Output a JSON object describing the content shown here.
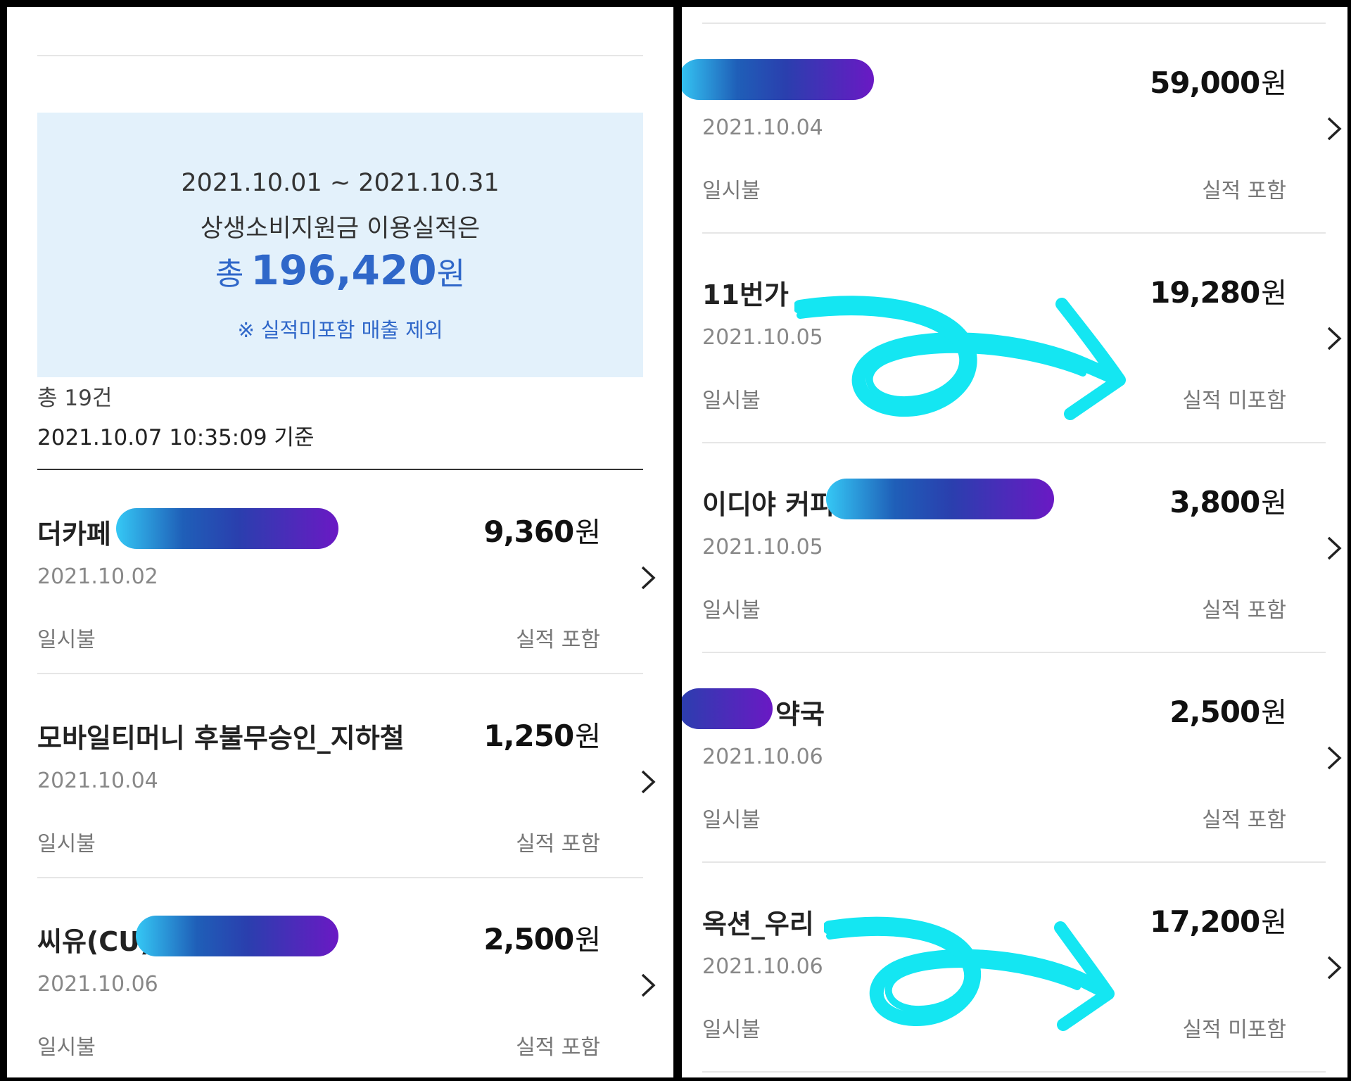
{
  "summary": {
    "date_range": "2021.10.01 ~ 2021.10.31",
    "label": "상생소비지원금 이용실적은",
    "total_prefix": "총",
    "total_amount": "196,420",
    "total_currency": "원",
    "note": "※ 실적미포함 매출 제외"
  },
  "list_info": {
    "count": "총 19건",
    "as_of": "2021.10.07 10:35:09 기준"
  },
  "left_transactions": [
    {
      "merchant": "더카페",
      "amount": "9,360",
      "currency": "원",
      "date": "2021.10.02",
      "payment_type": "일시불",
      "performance": "실적 포함"
    },
    {
      "merchant": "모바일티머니 후불무승인_지하철",
      "amount": "1,250",
      "currency": "원",
      "date": "2021.10.04",
      "payment_type": "일시불",
      "performance": "실적 포함"
    },
    {
      "merchant": "씨유(CU)",
      "amount": "2,500",
      "currency": "원",
      "date": "2021.10.06",
      "payment_type": "일시불",
      "performance": "실적 포함"
    }
  ],
  "right_transactions": [
    {
      "merchant": "",
      "amount": "59,000",
      "currency": "원",
      "date": "2021.10.04",
      "payment_type": "일시불",
      "performance": "실적 포함"
    },
    {
      "merchant": "11번가",
      "amount": "19,280",
      "currency": "원",
      "date": "2021.10.05",
      "payment_type": "일시불",
      "performance": "실적 미포함"
    },
    {
      "merchant": "이디야 커피",
      "amount": "3,800",
      "currency": "원",
      "date": "2021.10.05",
      "payment_type": "일시불",
      "performance": "실적 포함"
    },
    {
      "merchant": "약국",
      "amount": "2,500",
      "currency": "원",
      "date": "2021.10.06",
      "payment_type": "일시불",
      "performance": "실적 포함"
    },
    {
      "merchant": "옥션_우리",
      "amount": "17,200",
      "currency": "원",
      "date": "2021.10.06",
      "payment_type": "일시불",
      "performance": "실적 미포함"
    }
  ],
  "icons": {
    "chevron": "chevron-right-icon",
    "annotation": "arrow-annotation"
  },
  "colors": {
    "accent_blue": "#2f67c9",
    "summary_bg": "#e3f1fb",
    "annotation": "#14e6f2"
  }
}
